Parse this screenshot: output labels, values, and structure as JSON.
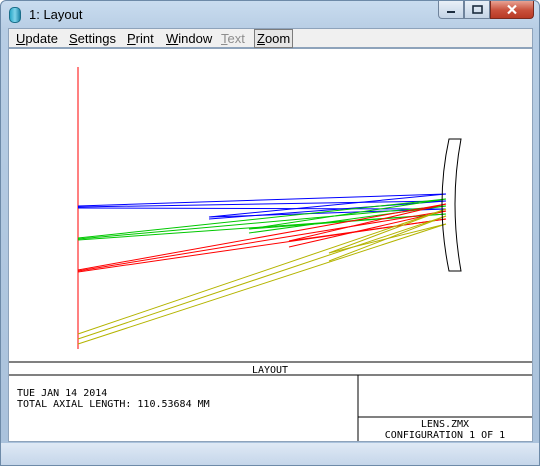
{
  "window": {
    "title": "1: Layout",
    "controls": {
      "minimize": "minimize-icon",
      "maximize": "maximize-icon",
      "close": "close-icon"
    }
  },
  "menu": [
    {
      "id": "update",
      "first": "U",
      "rest": "pdate",
      "state": "normal"
    },
    {
      "id": "settings",
      "first": "S",
      "rest": "ettings",
      "state": "normal"
    },
    {
      "id": "print",
      "first": "P",
      "rest": "rint",
      "state": "normal"
    },
    {
      "id": "window",
      "first": "W",
      "rest": "indow",
      "state": "normal"
    },
    {
      "id": "text",
      "first": "T",
      "rest": "ext",
      "state": "disabled"
    },
    {
      "id": "zoom",
      "first": "Z",
      "rest": "oom",
      "state": "selected"
    }
  ],
  "plot": {
    "field_colors": [
      "#0000ff",
      "#00c800",
      "#ff0000",
      "#b4b400"
    ],
    "axis_color": "#ff0000"
  },
  "info": {
    "heading": "LAYOUT",
    "date": "TUE JAN 14 2014",
    "axial_length": "TOTAL AXIAL LENGTH:  110.53684 MM",
    "file": "LENS.ZMX",
    "configuration": "CONFIGURATION  1 OF  1"
  }
}
